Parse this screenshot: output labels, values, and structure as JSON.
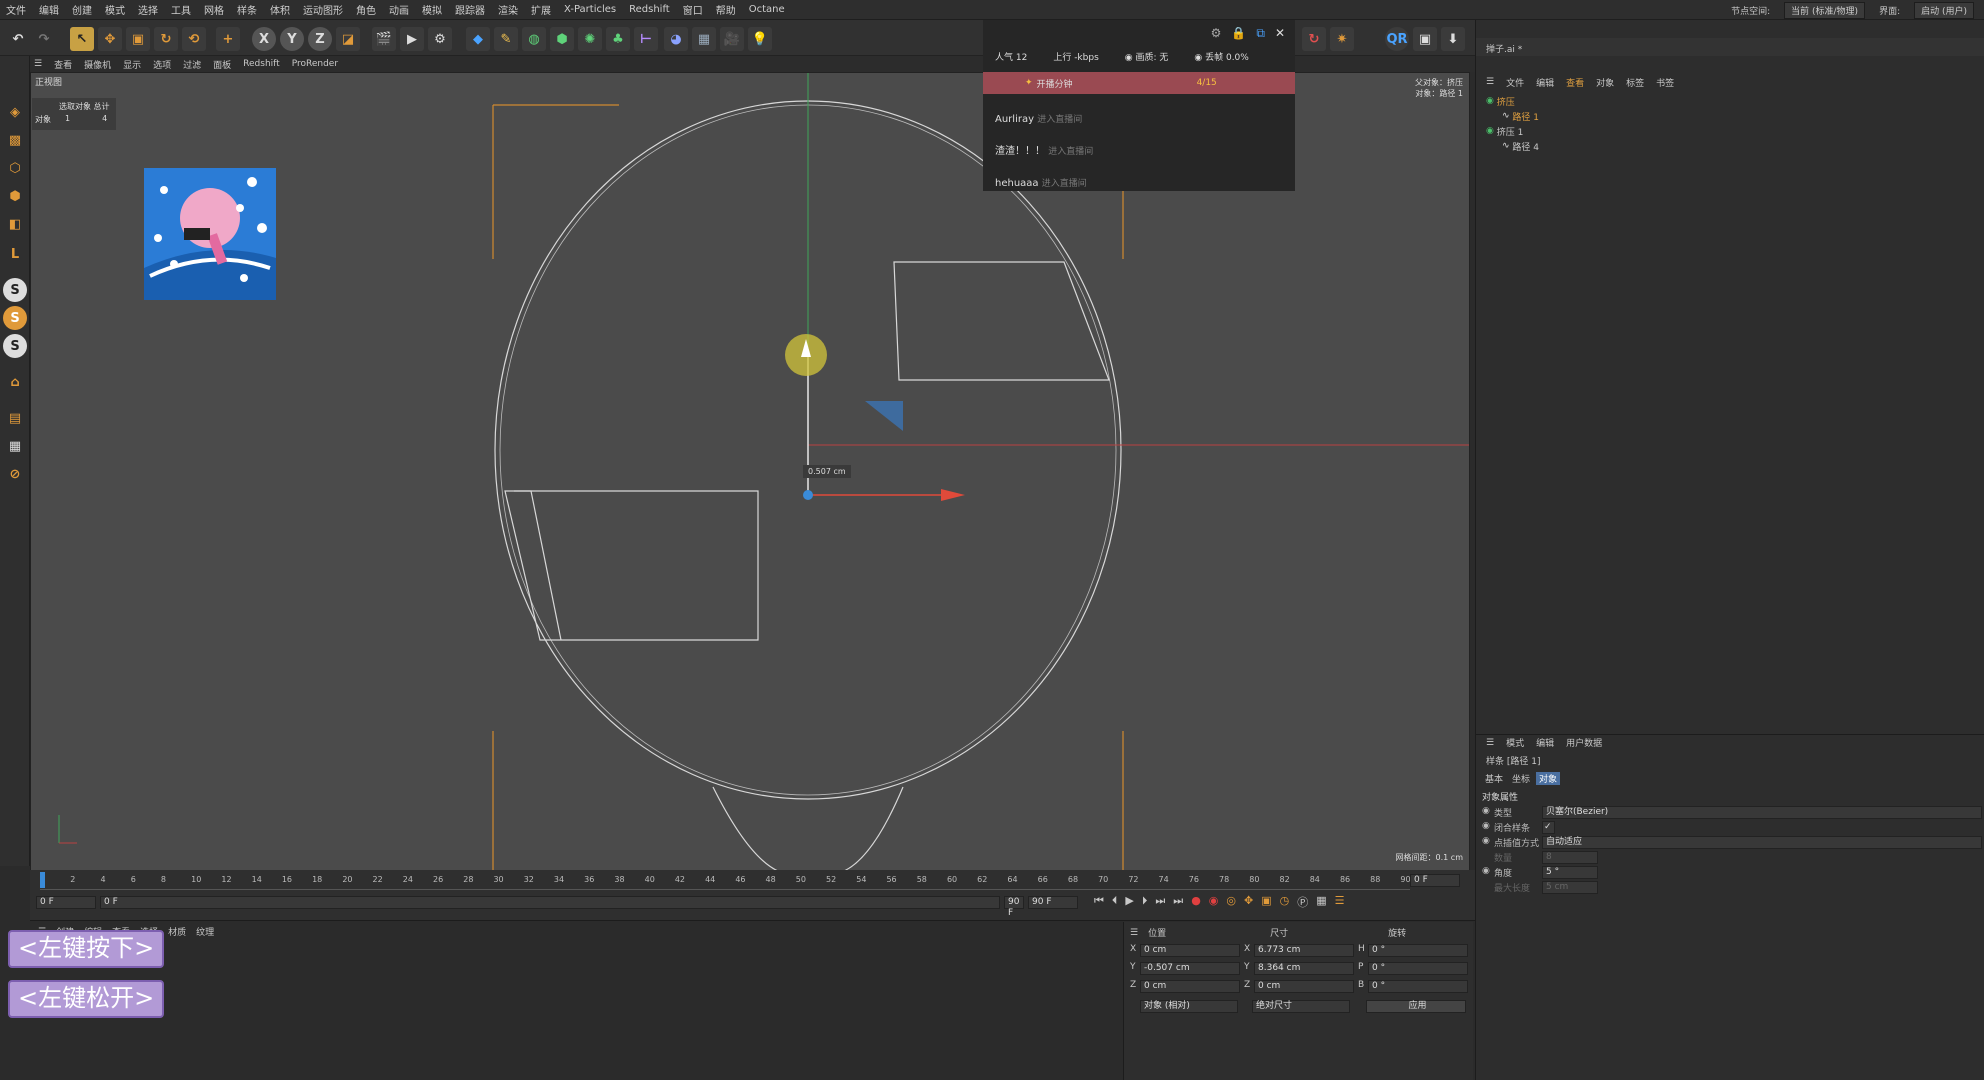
{
  "menu": [
    "文件",
    "编辑",
    "创建",
    "模式",
    "选择",
    "工具",
    "网格",
    "样条",
    "体积",
    "运动图形",
    "角色",
    "动画",
    "模拟",
    "跟踪器",
    "渲染",
    "扩展",
    "X-Particles",
    "Redshift",
    "窗口",
    "帮助",
    "Octane"
  ],
  "menu_right": {
    "node_space_label": "节点空间:",
    "node_space_value": "当前 (标准/物理)",
    "layout_label": "界面:",
    "layout_value": "启动 (用户)"
  },
  "viewport_menu": [
    "查看",
    "摄像机",
    "显示",
    "选项",
    "过滤",
    "面板",
    "Redshift",
    "ProRender"
  ],
  "viewport": {
    "name": "正视图",
    "stats_header": "选取对象 总计",
    "stats_label": "对象",
    "stats_selected": "1",
    "stats_total": "4",
    "top_right_1": "父对象：挤压",
    "top_right_2": "对象：路径 1",
    "measure": "0.507 cm",
    "grid_spacing": "网格间距：0.1 cm"
  },
  "live": {
    "popularity": "人气 12",
    "upload": "上行 -kbps",
    "quality": "画质: 无",
    "drop": "丢帧 0.0%",
    "start_label": "开播分钟",
    "start_count": "4/15",
    "entries": [
      {
        "name": "Aurliray",
        "action": "进入直播间"
      },
      {
        "name": "渣渣！！！",
        "action": "进入直播间"
      },
      {
        "name": "hehuaaa",
        "action": "进入直播间"
      }
    ]
  },
  "objects": {
    "title": "掸子.ai *",
    "tabs": [
      "文件",
      "编辑",
      "查看",
      "对象",
      "标签",
      "书签"
    ],
    "items": [
      {
        "name": "挤压",
        "indent": 0
      },
      {
        "name": "路径 1",
        "indent": 1
      },
      {
        "name": "挤压 1",
        "indent": 0
      },
      {
        "name": "路径 4",
        "indent": 1
      }
    ]
  },
  "attributes": {
    "tabs": [
      "模式",
      "编辑",
      "用户数据"
    ],
    "title": "样条 [路径 1]",
    "subtabs": [
      "基本",
      "坐标",
      "对象"
    ],
    "section": "对象属性",
    "props": [
      {
        "label": "类型",
        "value": "贝塞尔(Bezier)"
      },
      {
        "label": "闭合样条",
        "value": "✓"
      },
      {
        "label": "点插值方式",
        "value": "自动适应"
      },
      {
        "label": "数量",
        "value": "8"
      },
      {
        "label": "角度",
        "value": "5 °"
      },
      {
        "label": "最大长度",
        "value": "5 cm"
      }
    ]
  },
  "timeline": {
    "ticks": [
      "0",
      "2",
      "4",
      "6",
      "8",
      "10",
      "12",
      "14",
      "16",
      "18",
      "20",
      "22",
      "24",
      "26",
      "28",
      "30",
      "32",
      "34",
      "36",
      "38",
      "40",
      "42",
      "44",
      "46",
      "48",
      "50",
      "52",
      "54",
      "56",
      "58",
      "60",
      "62",
      "64",
      "66",
      "68",
      "70",
      "72",
      "74",
      "76",
      "78",
      "80",
      "82",
      "84",
      "86",
      "88",
      "90"
    ],
    "end_frame": "0 F",
    "start": "0 F",
    "current": "0 F",
    "max": "90 F",
    "max2": "90 F"
  },
  "material_menu": [
    "创建",
    "编辑",
    "查看",
    "选择",
    "材质",
    "纹理"
  ],
  "coords": {
    "headers": [
      "位置",
      "尺寸",
      "旋转"
    ],
    "rows": [
      {
        "axis": "X",
        "pos": "0 cm",
        "size": "6.773 cm",
        "rot_axis": "H",
        "rot": "0 °"
      },
      {
        "axis": "Y",
        "pos": "-0.507 cm",
        "size": "8.364 cm",
        "rot_axis": "P",
        "rot": "0 °"
      },
      {
        "axis": "Z",
        "pos": "0 cm",
        "size": "0 cm",
        "rot_axis": "B",
        "rot": "0 °"
      }
    ],
    "mode": "对象 (相对)",
    "size_mode": "绝对尺寸",
    "apply": "应用"
  },
  "overlays": {
    "press": "<左键按下>",
    "release": "<左键松开>"
  }
}
